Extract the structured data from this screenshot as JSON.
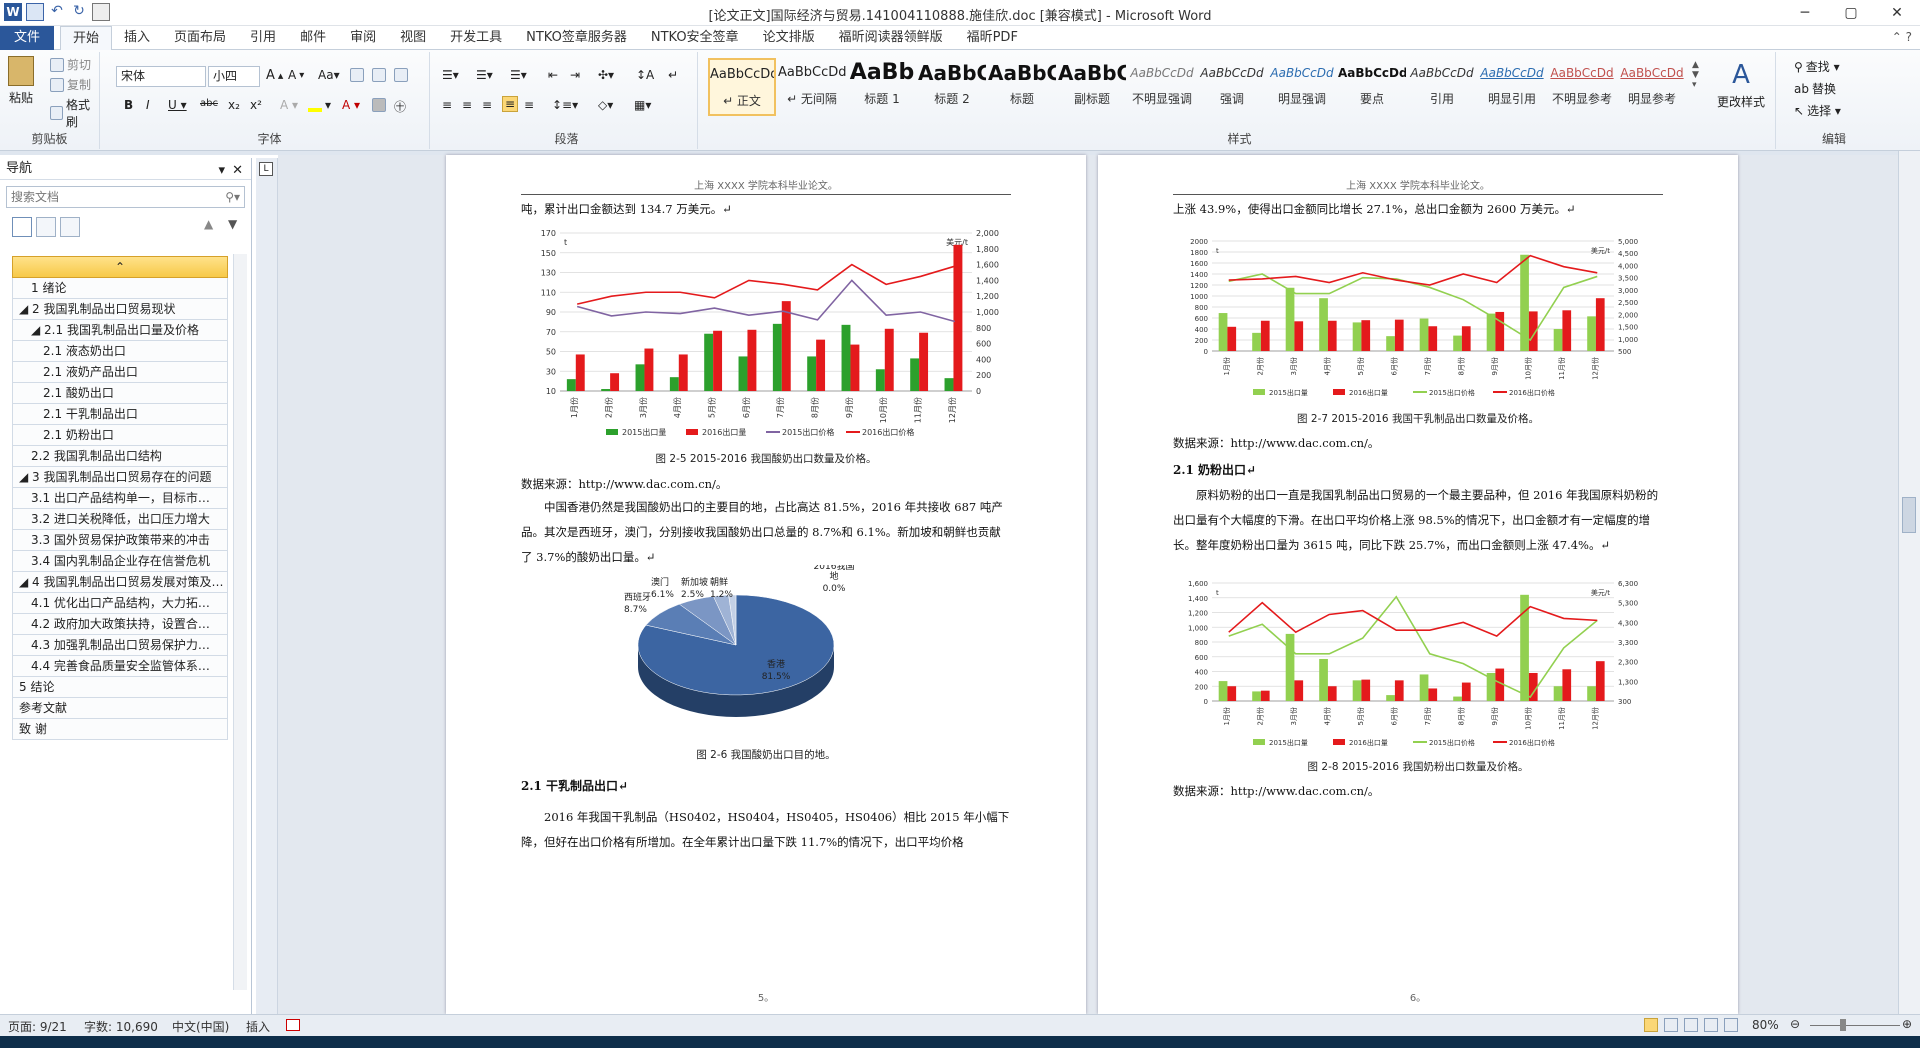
{
  "window": {
    "title": "[论文正文]国际经济与贸易.141004110888.施佳欣.doc [兼容模式] - Microsoft Word",
    "minimize": "─",
    "maximize": "▢",
    "close": "✕"
  },
  "tabs": {
    "file": "文件",
    "items": [
      "开始",
      "插入",
      "页面布局",
      "引用",
      "邮件",
      "审阅",
      "视图",
      "开发工具",
      "NTKO签章服务器",
      "NTKO安全签章",
      "论文排版",
      "福昕阅读器领鲜版",
      "福昕PDF"
    ]
  },
  "ribbon": {
    "clipboard": {
      "paste": "粘贴",
      "cut": "剪切",
      "copy": "复制",
      "format_painter": "格式刷",
      "label": "剪贴板"
    },
    "font": {
      "name": "宋体",
      "size": "小四",
      "label": "字体"
    },
    "paragraph": {
      "label": "段落"
    },
    "styles": {
      "label": "样式",
      "items": [
        {
          "preview": "AaBbCcDd",
          "name": "↵ 正文"
        },
        {
          "preview": "AaBbCcDd",
          "name": "↵ 无间隔"
        },
        {
          "preview": "AaBb",
          "name": "标题 1"
        },
        {
          "preview": "AaBbC",
          "name": "标题 2"
        },
        {
          "preview": "AaBbC",
          "name": "标题"
        },
        {
          "preview": "AaBbC",
          "name": "副标题"
        },
        {
          "preview": "AaBbCcDd",
          "name": "不明显强调"
        },
        {
          "preview": "AaBbCcDd",
          "name": "强调"
        },
        {
          "preview": "AaBbCcDd",
          "name": "明显强调"
        },
        {
          "preview": "AaBbCcDd",
          "name": "要点"
        },
        {
          "preview": "AaBbCcDd",
          "name": "引用"
        },
        {
          "preview": "AaBbCcDd",
          "name": "明显引用"
        },
        {
          "preview": "AaBbCcDd",
          "name": "不明显参考"
        },
        {
          "preview": "AaBbCcDd",
          "name": "明显参考"
        }
      ],
      "change": "更改样式"
    },
    "editing": {
      "find": "查找 ▾",
      "replace": "替换",
      "select": "选择 ▾",
      "label": "编辑"
    }
  },
  "nav": {
    "title": "导航",
    "search_placeholder": "搜索文档",
    "items": [
      {
        "label": "1 绪论",
        "level": 1
      },
      {
        "label": "◢ 2 我国乳制品出口贸易现状",
        "level": 0
      },
      {
        "label": "◢ 2.1 我国乳制品出口量及价格",
        "level": 1
      },
      {
        "label": "2.1 液态奶出口",
        "level": 2
      },
      {
        "label": "2.1 液奶产品出口",
        "level": 2
      },
      {
        "label": "2.1 酸奶出口",
        "level": 2
      },
      {
        "label": "2.1 干乳制品出口",
        "level": 2
      },
      {
        "label": "2.1 奶粉出口",
        "level": 2
      },
      {
        "label": "2.2 我国乳制品出口结构",
        "level": 1
      },
      {
        "label": "◢ 3 我国乳制品出口贸易存在的问题",
        "level": 0
      },
      {
        "label": "3.1 出口产品结构单一，目标市…",
        "level": 1
      },
      {
        "label": "3.2 进口关税降低，出口压力增大",
        "level": 1
      },
      {
        "label": "3.3 国外贸易保护政策带来的冲击",
        "level": 1
      },
      {
        "label": "3.4 国内乳制品企业存在信誉危机",
        "level": 1
      },
      {
        "label": "◢ 4 我国乳制品出口贸易发展对策及…",
        "level": 0
      },
      {
        "label": "4.1 优化出口产品结构，大力拓…",
        "level": 1
      },
      {
        "label": "4.2 政府加大政策扶持，设置合…",
        "level": 1
      },
      {
        "label": "4.3 加强乳制品出口贸易保护力…",
        "level": 1
      },
      {
        "label": "4.4 完善食品质量安全监管体系…",
        "level": 1
      },
      {
        "label": "5 结论",
        "level": 0
      },
      {
        "label": "参考文献",
        "level": 0
      },
      {
        "label": "致  谢",
        "level": 0
      }
    ]
  },
  "page_left": {
    "header": "上海 XXXX 学院本科毕业论文。",
    "line1": "吨，累计出口金额达到 134.7 万美元。↵",
    "cap1": "图 2-5 2015-2016 我国酸奶出口数量及价格。",
    "src1": "数据来源：http://www.dac.com.cn/。",
    "para1": "中国香港仍然是我国酸奶出口的主要目的地，占比高达 81.5%，2016 年共接收 687 吨产品。其次是西班牙，澳门，分别接收我国酸奶出口总量的 8.7%和 6.1%。新加坡和朝鲜也贡献了 3.7%的酸奶出口量。↵",
    "cap2": "图 2-6  我国酸奶出口目的地。",
    "h2": "2.1   干乳制品出口↵",
    "para2": "2016 年我国干乳制品（HS0402，HS0404，HS0405，HS0406）相比 2015 年小幅下降，但好在出口价格有所增加。在全年累计出口量下跌 11.7%的情况下，出口平均价格",
    "pnum": "5。"
  },
  "page_right": {
    "header": "上海 XXXX 学院本科毕业论文。",
    "line1": "上涨 43.9%，使得出口金额同比增长 27.1%，总出口金额为 2600 万美元。↵",
    "cap1": "图 2-7 2015-2016 我国干乳制品出口数量及价格。",
    "src1": "数据来源：http://www.dac.com.cn/。",
    "h2": "2.1   奶粉出口↵",
    "para1": "原料奶粉的出口一直是我国乳制品出口贸易的一个最主要品种，但 2016 年我国原料奶粉的出口量有个大幅度的下滑。在出口平均价格上涨 98.5%的情况下，出口金额才有一定幅度的增长。整年度奶粉出口量为 3615 吨，同比下跌 25.7%，而出口金额则上涨 47.4%。↵",
    "cap2": "图 2-8 2015-2016 我国奶粉出口数量及价格。",
    "src2": "数据来源：http://www.dac.com.cn/。",
    "pnum": "6。"
  },
  "status": {
    "page": "页面: 9/21",
    "words": "字数: 10,690",
    "lang": "中文(中国)",
    "mode": "插入",
    "zoom": "80%"
  },
  "chart_data": [
    {
      "type": "bar",
      "categories": [
        "1月份",
        "2月份",
        "3月份",
        "4月份",
        "5月份",
        "6月份",
        "7月份",
        "8月份",
        "9月份",
        "10月份",
        "11月份",
        "12月份"
      ],
      "series": [
        {
          "name": "2015出口量",
          "kind": "bar",
          "axis": "left",
          "color": "#2ca02c",
          "values": [
            22,
            12,
            37,
            24,
            68,
            45,
            78,
            45,
            77,
            32,
            43,
            23
          ]
        },
        {
          "name": "2016出口量",
          "kind": "bar",
          "axis": "left",
          "color": "#e41a1c",
          "values": [
            47,
            28,
            53,
            47,
            71,
            72,
            101,
            62,
            57,
            73,
            69,
            158
          ]
        },
        {
          "name": "2015出口价格",
          "kind": "line",
          "axis": "right",
          "color": "#8064a2",
          "values": [
            1070,
            950,
            1000,
            980,
            1050,
            960,
            1010,
            900,
            1400,
            960,
            1000,
            880
          ]
        },
        {
          "name": "2016出口价格",
          "kind": "line",
          "axis": "right",
          "color": "#e41a1c",
          "values": [
            1100,
            1200,
            1250,
            1250,
            1180,
            1400,
            1350,
            1280,
            1600,
            1350,
            1450,
            1580
          ]
        }
      ],
      "ylabel": "t",
      "y2label": "美元/t",
      "ylim": [
        10,
        170
      ],
      "yticks": [
        10,
        30,
        50,
        70,
        90,
        110,
        130,
        150,
        170
      ],
      "y2lim": [
        0,
        2000
      ],
      "y2ticks": [
        0,
        200,
        400,
        600,
        800,
        "1,000",
        "1,200",
        "1,400",
        "1,600",
        "1,800",
        "2,000"
      ]
    },
    {
      "type": "pie",
      "title": "2016我国酸奶出口目的地",
      "slices": [
        {
          "label": "香港",
          "value": 81.5,
          "text": "81.5%"
        },
        {
          "label": "西班牙",
          "value": 8.7,
          "text": "8.7%"
        },
        {
          "label": "澳门",
          "value": 6.1,
          "text": "6.1%"
        },
        {
          "label": "新加坡",
          "value": 2.5,
          "text": "2.5%"
        },
        {
          "label": "朝鲜",
          "value": 1.2,
          "text": "1.2%"
        },
        {
          "label": "地",
          "value": 0.0,
          "text": "0.0%"
        }
      ]
    },
    {
      "type": "bar",
      "categories": [
        "1月份",
        "2月份",
        "3月份",
        "4月份",
        "5月份",
        "6月份",
        "7月份",
        "8月份",
        "9月份",
        "10月份",
        "11月份",
        "12月份"
      ],
      "series": [
        {
          "name": "2015出口量",
          "kind": "bar",
          "axis": "left",
          "color": "#92d050",
          "values": [
            690,
            330,
            1150,
            960,
            520,
            270,
            590,
            280,
            680,
            1750,
            400,
            630
          ]
        },
        {
          "name": "2016出口量",
          "kind": "bar",
          "axis": "left",
          "color": "#e41a1c",
          "values": [
            440,
            550,
            540,
            550,
            560,
            570,
            450,
            450,
            710,
            720,
            740,
            960
          ]
        },
        {
          "name": "2015出口价格",
          "kind": "line",
          "axis": "right",
          "color": "#92d050",
          "values": [
            3350,
            3650,
            2850,
            2850,
            3500,
            3450,
            3100,
            2600,
            1800,
            950,
            3100,
            3550
          ]
        },
        {
          "name": "2016出口价格",
          "kind": "line",
          "axis": "right",
          "color": "#e41a1c",
          "values": [
            3400,
            3450,
            3550,
            3300,
            3700,
            3400,
            3200,
            3650,
            3300,
            4400,
            3950,
            3700
          ]
        }
      ],
      "ylabel": "t",
      "y2label": "美元/t",
      "ylim": [
        0,
        2000
      ],
      "yticks": [
        0,
        200,
        400,
        600,
        800,
        1000,
        1200,
        1400,
        1600,
        1800,
        2000
      ],
      "y2lim": [
        500,
        5000
      ],
      "y2ticks": [
        500,
        "1,000",
        "1,500",
        "2,000",
        "2,500",
        "3,000",
        "3,500",
        "4,000",
        "4,500",
        "5,000"
      ]
    },
    {
      "type": "bar",
      "categories": [
        "1月份",
        "2月份",
        "3月份",
        "4月份",
        "5月份",
        "6月份",
        "7月份",
        "8月份",
        "9月份",
        "10月份",
        "11月份",
        "12月份"
      ],
      "series": [
        {
          "name": "2015出口量",
          "kind": "bar",
          "axis": "left",
          "color": "#92d050",
          "values": [
            270,
            130,
            910,
            570,
            280,
            80,
            360,
            60,
            380,
            1440,
            200,
            200
          ]
        },
        {
          "name": "2016出口量",
          "kind": "bar",
          "axis": "left",
          "color": "#e41a1c",
          "values": [
            200,
            140,
            280,
            200,
            290,
            280,
            170,
            250,
            440,
            380,
            430,
            540
          ]
        },
        {
          "name": "2015出口价格",
          "kind": "line",
          "axis": "right",
          "color": "#92d050",
          "values": [
            3600,
            4200,
            2700,
            2700,
            3500,
            5600,
            2700,
            2200,
            1300,
            500,
            3000,
            4400
          ]
        },
        {
          "name": "2016出口价格",
          "kind": "line",
          "axis": "right",
          "color": "#e41a1c",
          "values": [
            3800,
            5300,
            3800,
            4700,
            4900,
            3900,
            3900,
            4300,
            3600,
            5100,
            4500,
            4400
          ]
        }
      ],
      "ylabel": "t",
      "y2label": "美元/t",
      "ylim": [
        0,
        1600
      ],
      "yticks": [
        0,
        200,
        400,
        600,
        800,
        "1,000",
        "1,200",
        "1,400",
        "1,600"
      ],
      "y2lim": [
        300,
        6300
      ],
      "y2ticks": [
        300,
        "1,300",
        "2,300",
        "3,300",
        "4,300",
        "5,300",
        "6,300"
      ]
    }
  ]
}
